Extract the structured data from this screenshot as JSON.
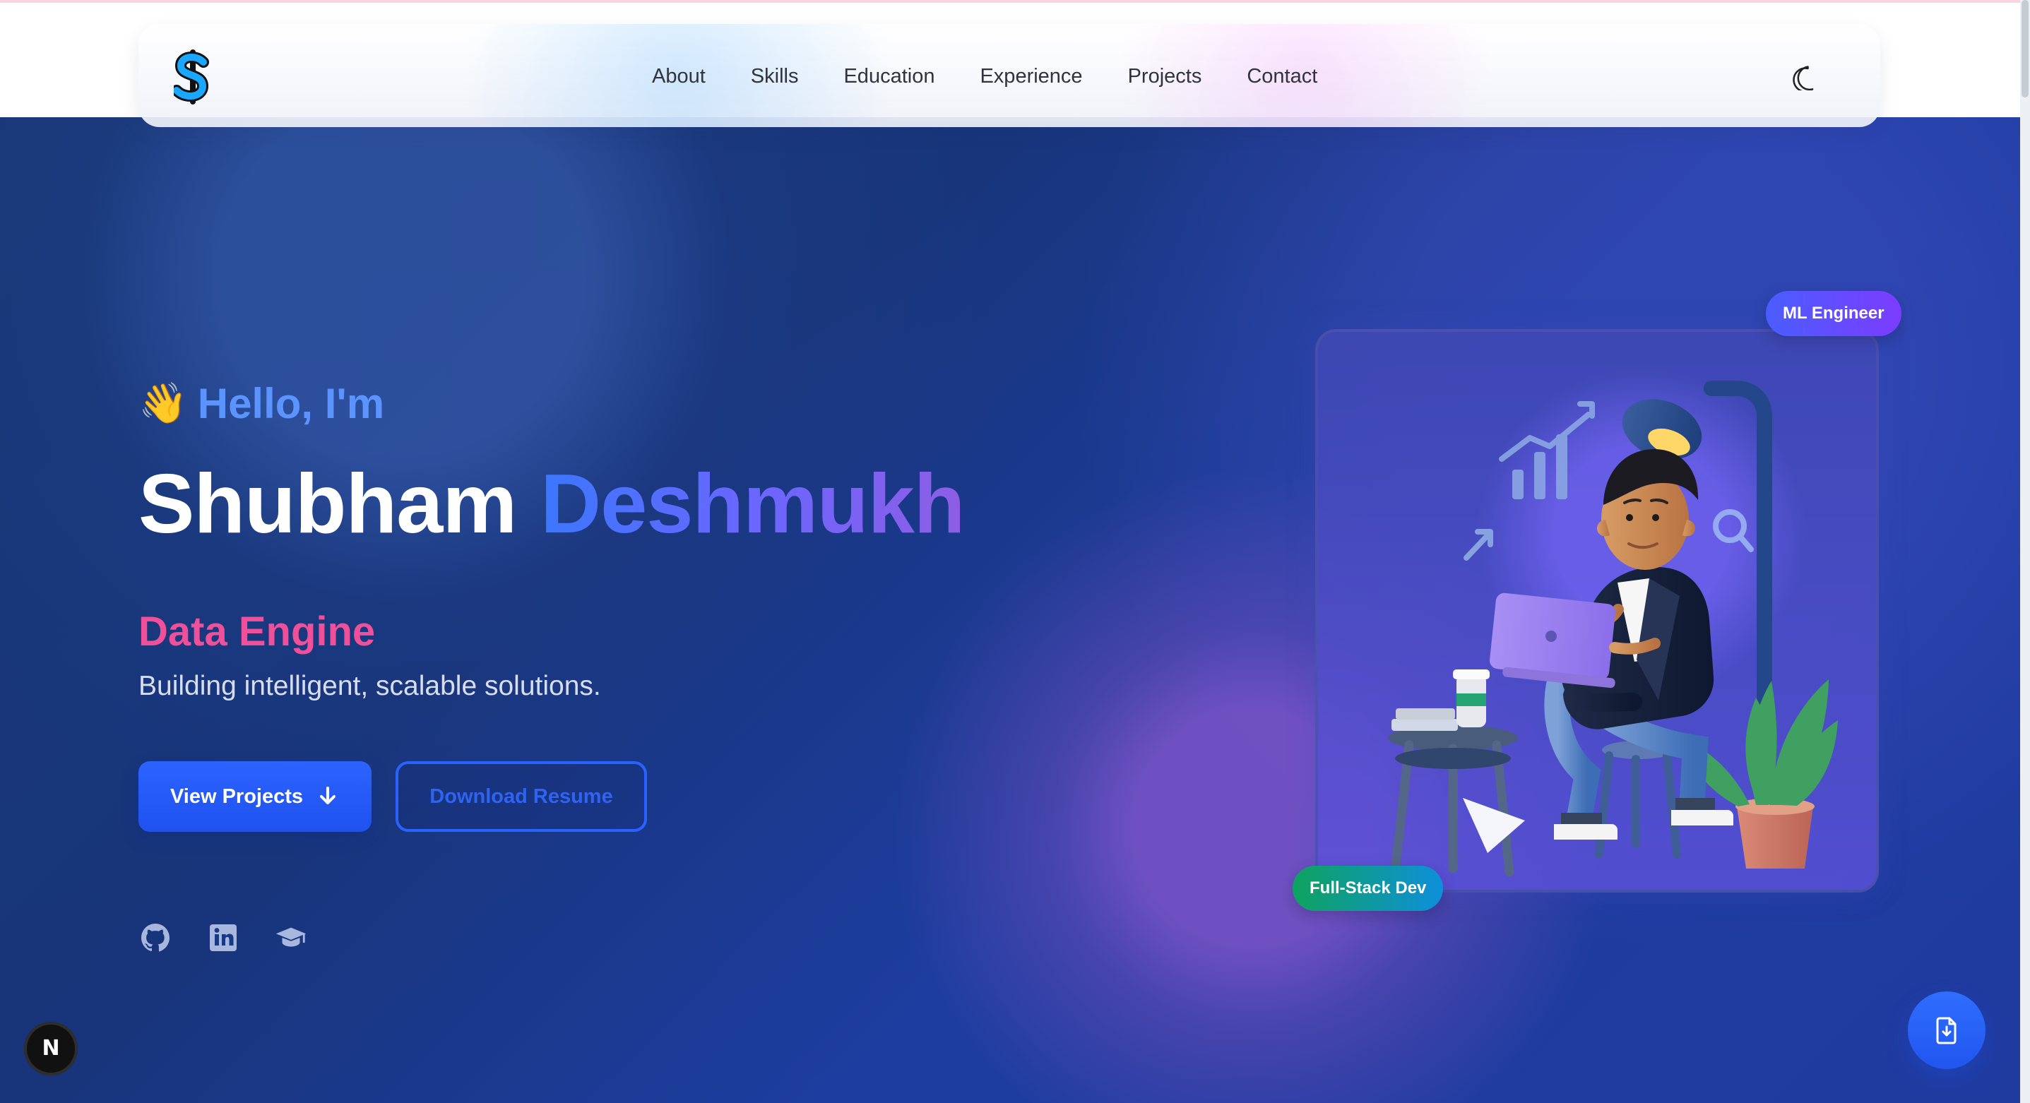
{
  "nav": {
    "links": [
      "About",
      "Skills",
      "Education",
      "Experience",
      "Projects",
      "Contact"
    ],
    "logo_icon": "dollar-sign-icon",
    "theme_icon": "moon-icon"
  },
  "hero": {
    "greeting_emoji": "👋",
    "greeting": "Hello, I'm",
    "first_name": "Shubham",
    "last_name": "Deshmukh",
    "role": "Data Engine",
    "subtitle": "Building intelligent, scalable solutions.",
    "primary_button": "View Projects",
    "secondary_button": "Download Resume",
    "social_icons": [
      "github-icon",
      "linkedin-icon",
      "graduation-cap-icon"
    ]
  },
  "illustration": {
    "badges": [
      "ML Engineer",
      "Full-Stack Dev"
    ]
  },
  "floating": {
    "bottom_left": "N",
    "bottom_right_icon": "file-download-icon"
  },
  "colors": {
    "accent_blue": "#2c63ff",
    "accent_pink": "#f04f9a",
    "hero_dark": "#173776"
  }
}
